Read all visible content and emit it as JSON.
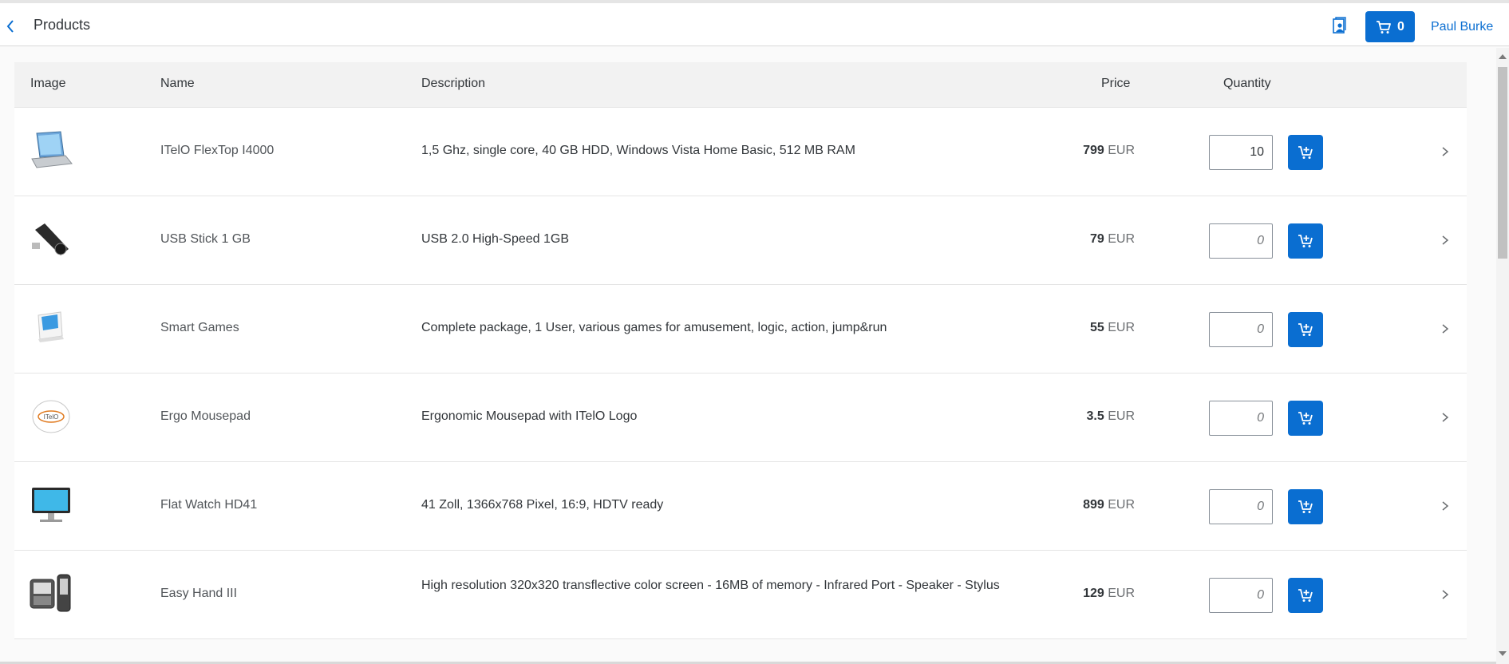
{
  "header": {
    "title": "Products",
    "cart_count": "0",
    "user_name": "Paul Burke"
  },
  "table": {
    "columns": {
      "image": "Image",
      "name": "Name",
      "description": "Description",
      "price": "Price",
      "quantity": "Quantity"
    },
    "rows": [
      {
        "name": "ITelO FlexTop I4000",
        "description": "1,5 Ghz, single core, 40 GB HDD, Windows Vista Home Basic, 512 MB RAM",
        "price": "799",
        "currency": "EUR",
        "quantity": "10",
        "image_icon": "laptop-image"
      },
      {
        "name": "USB Stick 1 GB",
        "description": "USB 2.0 High-Speed 1GB",
        "price": "79",
        "currency": "EUR",
        "quantity": "",
        "image_icon": "usb-stick-image"
      },
      {
        "name": "Smart Games",
        "description": "Complete package, 1 User, various games for amusement, logic, action, jump&run",
        "price": "55",
        "currency": "EUR",
        "quantity": "",
        "image_icon": "software-box-image"
      },
      {
        "name": "Ergo Mousepad",
        "description": "Ergonomic Mousepad with ITelO Logo",
        "price": "3.5",
        "currency": "EUR",
        "quantity": "",
        "image_icon": "mousepad-image"
      },
      {
        "name": "Flat Watch HD41",
        "description": "41 Zoll, 1366x768 Pixel, 16:9, HDTV ready",
        "price": "899",
        "currency": "EUR",
        "quantity": "",
        "image_icon": "monitor-image"
      },
      {
        "name": "Easy Hand III",
        "description": "High resolution 320x320 transflective color screen - 16MB of memory - Infrared Port - Speaker - Stylus",
        "price": "129",
        "currency": "EUR",
        "quantity": "",
        "image_icon": "pda-image"
      }
    ],
    "quantity_placeholder": "0"
  },
  "colors": {
    "accent": "#0a6ed1",
    "header_bg": "#f2f2f2"
  }
}
